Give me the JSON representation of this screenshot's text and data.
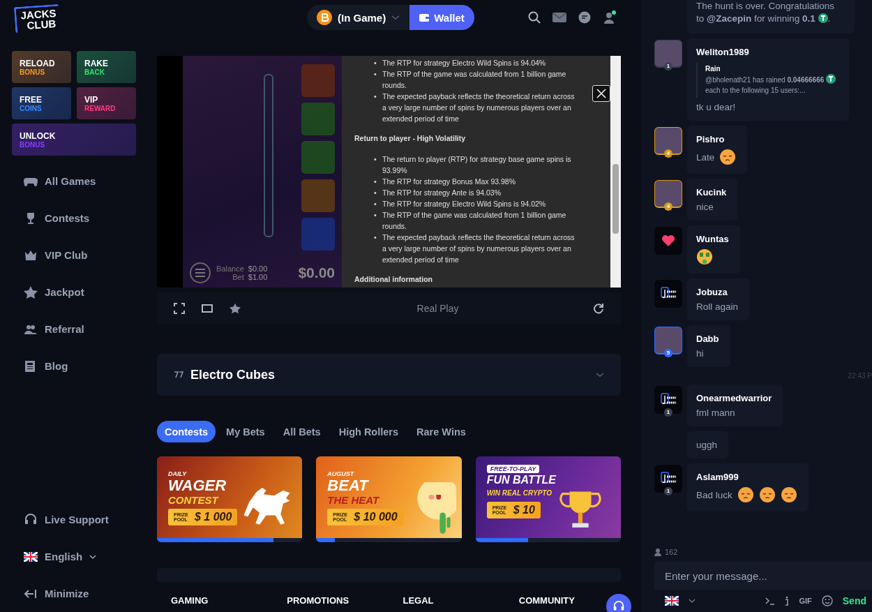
{
  "sidebar": {
    "logo": {
      "top": "JACKS",
      "bottom": "CLUB"
    },
    "promos": [
      {
        "title": "RELOAD",
        "subtitle": "BONUS",
        "color": "#f59a23",
        "wide": false
      },
      {
        "title": "RAKE",
        "subtitle": "BACK",
        "color": "#2ee66b",
        "wide": false
      },
      {
        "title": "FREE",
        "subtitle": "COINS",
        "color": "#3d8bff",
        "wide": false
      },
      {
        "title": "VIP",
        "subtitle": "REWARD",
        "color": "#ff3d7f",
        "wide": false
      },
      {
        "title": "UNLOCK",
        "subtitle": "BONUS",
        "color": "#8b3dff",
        "wide": true
      }
    ],
    "nav": [
      {
        "label": "All Games"
      },
      {
        "label": "Contests"
      },
      {
        "label": "VIP Club"
      },
      {
        "label": "Jackpot"
      },
      {
        "label": "Referral"
      },
      {
        "label": "Blog"
      }
    ],
    "bottom": [
      {
        "kind": "support",
        "label": "Live Support"
      },
      {
        "kind": "language",
        "label": "English"
      },
      {
        "kind": "minimize",
        "label": "Minimize"
      }
    ]
  },
  "topbar": {
    "balance": "(In Game)",
    "wallet": "Wallet"
  },
  "game": {
    "balance_label": "Balance",
    "balance": "$0.00",
    "bet_label": "Bet",
    "bet": "$1.00",
    "win": "$0.00",
    "info": [
      {
        "kind": "list",
        "marker": "•",
        "items": [
          "The RTP for strategy Electro Wild Spins is 94.04%",
          "The RTP of the game was calculated from 1 billion game rounds.",
          "The expected payback reflects the theoretical return across a very large number of spins by numerous players over an extended period of time"
        ]
      },
      {
        "kind": "heading",
        "text": "Return to player - High Volatility"
      },
      {
        "kind": "list",
        "marker": "•",
        "items": [
          "The return to player (RTP) for strategy base game spins is 93.99%",
          "The RTP for strategy Bonus Max 93.98%",
          "The RTP for strategy Ante is 94.03%",
          "The RTP for strategy Electro Wild Spins is 94.02%",
          "The RTP of the game was calculated from 1 billion game rounds.",
          "The expected payback reflects the theoretical return across a very large number of spins by numerous players over an extended period of time"
        ]
      },
      {
        "kind": "heading",
        "text": "Additional information"
      }
    ],
    "mode": "Real Play",
    "title": "Electro Cubes"
  },
  "tabs": [
    {
      "label": "Contests",
      "selected": true
    },
    {
      "label": "My Bets",
      "selected": false
    },
    {
      "label": "All Bets",
      "selected": false
    },
    {
      "label": "High Rollers",
      "selected": false
    },
    {
      "label": "Rare Wins",
      "selected": false
    }
  ],
  "contests": [
    {
      "kind": "wager",
      "top": "DAILY",
      "title": "WAGER",
      "subtitle": "CONTEST",
      "prize_label": "PRIZE POOL",
      "prize": "$ 1 000",
      "level": 0.8
    },
    {
      "kind": "heat",
      "top": "AUGUST",
      "title": "BEAT",
      "subtitle": "THE HEAT",
      "prize_label": "PRIZE POOL",
      "prize": "$ 10 000",
      "level": 0.13
    },
    {
      "kind": "battle",
      "top": "FREE-TO-PLAY",
      "title": "FUN BATTLE",
      "subtitle": "WIN REAL CRYPTO",
      "prize_label": "PRIZE POOL",
      "prize": "$ 10",
      "level": 0.36
    }
  ],
  "footer": {
    "headings": [
      "GAMING",
      "PROMOTIONS",
      "LEGAL",
      "COMMUNITY"
    ]
  },
  "chat": {
    "messages": [
      {
        "kind": "system",
        "text": "The hunt is over. Congratulations to **@Zacepin** for winning **0.1**",
        "suffix": "."
      },
      {
        "kind": "user",
        "avatar": {
          "kind": "photo"
        },
        "badge": {
          "text": "1",
          "color": "#3a4152"
        },
        "user": "Weliton1989",
        "quote": {
          "title": "Rain",
          "text": "@bholenath21 has rained **0.04666666**",
          "after": "each to the following 15 users:..."
        },
        "text": "tk u dear!"
      },
      {
        "kind": "user",
        "avatar": {
          "kind": "photo"
        },
        "badge": {
          "text": "4",
          "color": "#d69a1a"
        },
        "user": "Pishro",
        "text": "Late",
        "emojis": [
          {
            "kind": "pensive"
          }
        ]
      },
      {
        "kind": "user",
        "avatar": {
          "kind": "photo"
        },
        "badge": {
          "text": "4",
          "color": "#d69a1a"
        },
        "user": "Kucink",
        "text": "nice"
      },
      {
        "kind": "user",
        "avatar": {
          "kind": "heart"
        },
        "user": "Wuntas",
        "emojis": [
          {
            "kind": "money"
          }
        ]
      },
      {
        "kind": "user",
        "avatar": {
          "kind": "logo"
        },
        "user": "Jobuza",
        "text": "Roll again"
      },
      {
        "kind": "user",
        "avatar": {
          "kind": "photo"
        },
        "badge": {
          "text": "5",
          "color": "#2f6bff"
        },
        "user": "Dabb",
        "text": "hi"
      },
      {
        "kind": "time",
        "text": "22:43 P"
      },
      {
        "kind": "user",
        "avatar": {
          "kind": "logo"
        },
        "badge": {
          "text": "1",
          "color": "#3a4152"
        },
        "user": "Onearmedwarrior",
        "text": "fml mann"
      },
      {
        "kind": "followup",
        "text": "uggh"
      },
      {
        "kind": "user",
        "avatar": {
          "kind": "logo"
        },
        "badge": {
          "text": "1",
          "color": "#3a4152"
        },
        "user": "Aslam999",
        "text": "Bad luck",
        "emojis": [
          {
            "kind": "pensive"
          },
          {
            "kind": "pensive"
          },
          {
            "kind": "pensive"
          }
        ]
      }
    ],
    "online": "162",
    "placeholder": "Enter your message...",
    "gif": "GIF",
    "send": "Send"
  }
}
